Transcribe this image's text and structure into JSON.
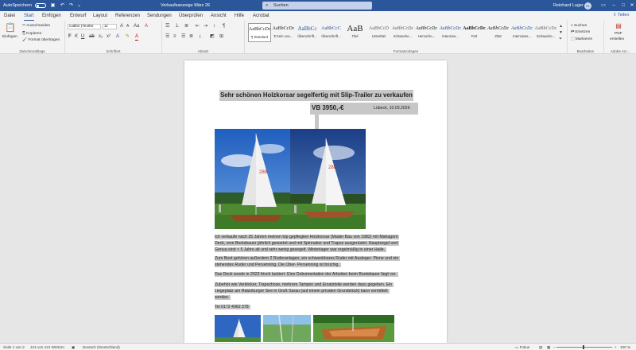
{
  "titlebar": {
    "autosave_label": "AutoSpeichern",
    "autosave_state": "Aus",
    "doc_title": "Verkaufsanzeige März 26",
    "search_placeholder": "Suchen",
    "user_name": "Reinhard Luger",
    "user_initials": "RL"
  },
  "tabs": [
    "Datei",
    "Start",
    "Einfügen",
    "Entwurf",
    "Layout",
    "Referenzen",
    "Sendungen",
    "Überprüfen",
    "Ansicht",
    "Hilfe",
    "Acrobat"
  ],
  "share_label": "Teilen",
  "ribbon": {
    "clipboard": {
      "paste_label": "Einfügen",
      "cut_label": "Ausschneiden",
      "copy_label": "Kopieren",
      "format_label": "Format übertragen",
      "group_label": "Zwischenablage"
    },
    "font": {
      "font_name": "Calibri (Textkö",
      "font_size": "11",
      "group_label": "Schriftart"
    },
    "paragraph": {
      "group_label": "Absatz"
    },
    "styles": {
      "group_label": "Formatvorlagen",
      "items": [
        {
          "preview": "AaBbCcDc",
          "name": "¶ Standard"
        },
        {
          "preview": "AaBbCcDc",
          "name": "¶ Kein Lee..."
        },
        {
          "preview": "AaBbCc",
          "name": "Überschrift..."
        },
        {
          "preview": "AaBbCcC",
          "name": "Überschrift..."
        },
        {
          "preview": "AaB",
          "name": "Titel"
        },
        {
          "preview": "AaBbCcD",
          "name": "Untertitel"
        },
        {
          "preview": "AaBbCcDc",
          "name": "Schwache..."
        },
        {
          "preview": "AaBbCcDc",
          "name": "Hervorho..."
        },
        {
          "preview": "AaBbCcDc",
          "name": "Intensive..."
        },
        {
          "preview": "AaBbCcDc",
          "name": "Fett"
        },
        {
          "preview": "AaBbCcDc",
          "name": "Zitat"
        },
        {
          "preview": "AaBbCcDc",
          "name": "Intensives..."
        },
        {
          "preview": "AaBbCcDc",
          "name": "Schwache..."
        }
      ]
    },
    "editing": {
      "search_label": "Suchen",
      "replace_label": "Ersetzen",
      "select_label": "Markieren",
      "group_label": "Bearbeiten"
    },
    "acrobat": {
      "pdf_label": "PDF",
      "create_label": "erstellen",
      "group_label": "Adobe Acr..."
    }
  },
  "document": {
    "title": "Sehr schönen Holzkorsar segelfertig mit Slip-Trailer zu verkaufen",
    "price": "VB 3950,-€",
    "place_date": "Lübeck, 10.03.2026",
    "paragraphs": [
      [
        "Ich verkaufe nach 25 Jahren meinen top gepflegten Holzkorsar (Mader Bau von 1982) mit Mahagoni",
        "Deck, vom Bootsbauer jährlich gewartet und mit Spinnaker und Trapez ausgerüstet. Hauptsegel und",
        "Genua sind < 5 Jahre alt und sehr wenig gesegelt. Winterlager war regelmäßig in einer Halle."
      ],
      [
        "Zum Boot gehören außerdem 2 Ruderanlagen, ein schwenkbares Ruder mit Ausleger- Pinne und ein",
        "stehendes Ruder und Persenning. Die Ober- Persenning ist brüchig."
      ],
      [
        "Das Deck wurde in 2023 frisch lackiert. Eine Dokumentation der Arbeiten beim Bootsbauer liegt vor."
      ],
      [
        "Zubehör wie Verklicker, Trapezhose, mehrere Tampen und Ersatzteile werden dazu gegeben. Ein",
        "Liegeplatz am Ratzeburger See in Groß Sarau (auf einem privaten Grundstück) kann vermittelt",
        "werden."
      ],
      [
        "Tel 0172 4062 378"
      ]
    ]
  },
  "statusbar": {
    "page": "Seite 1 von 2",
    "words": "124 von 124 Wörtern",
    "language": "Deutsch (Deutschland)",
    "focus": "Fokus",
    "zoom": "100 %"
  },
  "colors": {
    "brand": "#2b579a",
    "selection": "#c7c7c7"
  }
}
